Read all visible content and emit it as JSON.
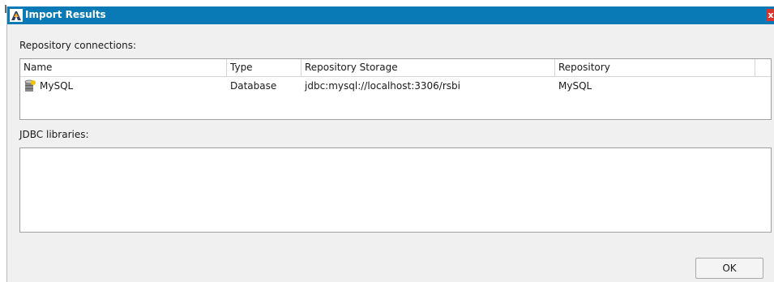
{
  "window": {
    "title": "Import Results",
    "close_glyph": "x"
  },
  "repository_section": {
    "label": "Repository connections:",
    "columns": [
      "Name",
      "Type",
      "Repository Storage",
      "Repository"
    ],
    "rows": [
      {
        "icon": "database-icon",
        "name": "MySQL",
        "type": "Database",
        "storage": "jdbc:mysql://localhost:3306/rsbi",
        "repository": "MySQL"
      }
    ]
  },
  "jdbc_section": {
    "label": "JDBC libraries:",
    "items": []
  },
  "footer": {
    "ok_label": "OK"
  },
  "colors": {
    "titlebar": "#0a7ab7",
    "dialog_bg": "#f0f0f0",
    "close": "#d9342b"
  }
}
